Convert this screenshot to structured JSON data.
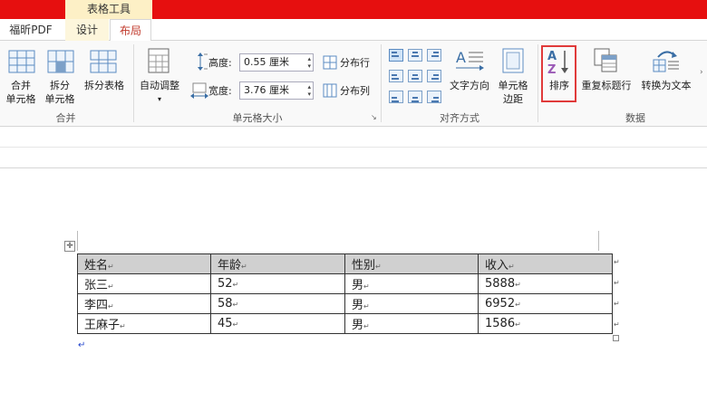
{
  "context_tab": "表格工具",
  "tabs": [
    {
      "label": "福昕PDF"
    },
    {
      "label": "设计"
    },
    {
      "label": "布局"
    }
  ],
  "ribbon": {
    "merge_group": {
      "label": "合并",
      "merge_cells": [
        "合并",
        "单元格"
      ],
      "split_cells": [
        "拆分",
        "单元格"
      ],
      "split_table": "拆分表格"
    },
    "cell_size_group": {
      "label": "单元格大小",
      "autofit": "自动调整",
      "height_label": "高度:",
      "height_value": "0.55 厘米",
      "width_label": "宽度:",
      "width_value": "3.76 厘米",
      "distribute_rows": "分布行",
      "distribute_cols": "分布列"
    },
    "alignment_group": {
      "label": "对齐方式",
      "text_direction": "文字方向",
      "cell_margins": [
        "单元格",
        "边距"
      ]
    },
    "data_group": {
      "label": "数据",
      "sort": "排序",
      "repeat_header": "重复标题行",
      "convert_to_text": "转换为文本"
    }
  },
  "colors": {
    "title_bar": "#e60f0f",
    "context_tab": "#fdf0c6",
    "header_row": "#d0d0d0",
    "highlight": "#e03a3a"
  },
  "table": {
    "headers": [
      "姓名",
      "年龄",
      "性别",
      "收入"
    ],
    "rows": [
      [
        "张三",
        "52",
        "男",
        "5888"
      ],
      [
        "李四",
        "58",
        "男",
        "6952"
      ],
      [
        "王麻子",
        "45",
        "男",
        "1586"
      ]
    ]
  }
}
